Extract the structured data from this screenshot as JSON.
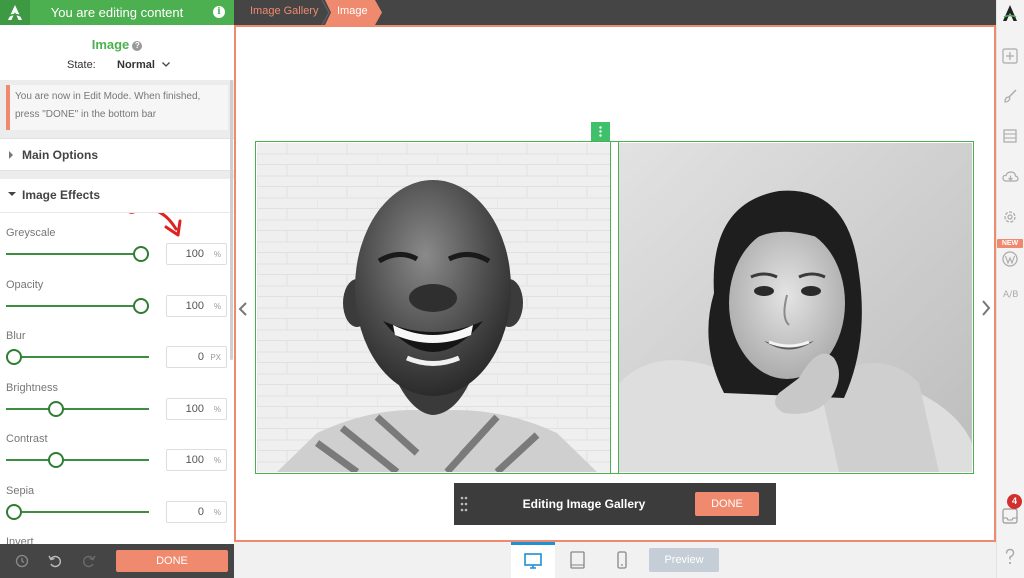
{
  "header": {
    "title": "You are editing content",
    "info_icon_text": "i"
  },
  "element": {
    "title": "Image",
    "state_label": "State:",
    "state_value": "Normal"
  },
  "notice": {
    "line1": "You are now in Edit Mode. When finished,",
    "line2": "press \"DONE\" in the bottom bar"
  },
  "sections": {
    "main_options": "Main Options",
    "image_effects": "Image Effects"
  },
  "effects": [
    {
      "label": "Greyscale",
      "value": "100",
      "unit": "%",
      "slider_fraction": 1.0
    },
    {
      "label": "Opacity",
      "value": "100",
      "unit": "%",
      "slider_fraction": 1.0
    },
    {
      "label": "Blur",
      "value": "0",
      "unit": "PX",
      "slider_fraction": 0.0
    },
    {
      "label": "Brightness",
      "value": "100",
      "unit": "%",
      "slider_fraction": 0.33
    },
    {
      "label": "Contrast",
      "value": "100",
      "unit": "%",
      "slider_fraction": 0.33
    },
    {
      "label": "Sepia",
      "value": "0",
      "unit": "%",
      "slider_fraction": 0.0
    },
    {
      "label": "Invert",
      "value": "",
      "unit": "",
      "slider_fraction": 0.0
    }
  ],
  "footer": {
    "done_label": "DONE"
  },
  "breadcrumb": {
    "parent": "Image Gallery",
    "current": "Image"
  },
  "edit_bar": {
    "label": "Editing Image Gallery",
    "done_label": "DONE"
  },
  "devices": {
    "preview_label": "Preview"
  },
  "rail": {
    "new_badge": "NEW",
    "notification_count": "4",
    "ab_label": "A/B"
  },
  "colors": {
    "brand_green": "#4caf50",
    "accent_orange": "#ef8a6f",
    "dark_bar": "#454545",
    "slider_green": "#2e7d32"
  },
  "icons": [
    "logo-icon",
    "info-icon",
    "help-icon",
    "chevron-down-icon",
    "caret-right-icon",
    "caret-down-icon",
    "history-icon",
    "undo-icon",
    "redo-icon",
    "chevron-left-icon",
    "chevron-right-icon",
    "drag-icon",
    "desktop-icon",
    "tablet-icon",
    "mobile-icon",
    "add-icon",
    "brush-icon",
    "layers-icon",
    "cloud-icon",
    "gear-icon",
    "wordpress-icon",
    "ab-test-icon",
    "tray-icon",
    "question-icon"
  ]
}
